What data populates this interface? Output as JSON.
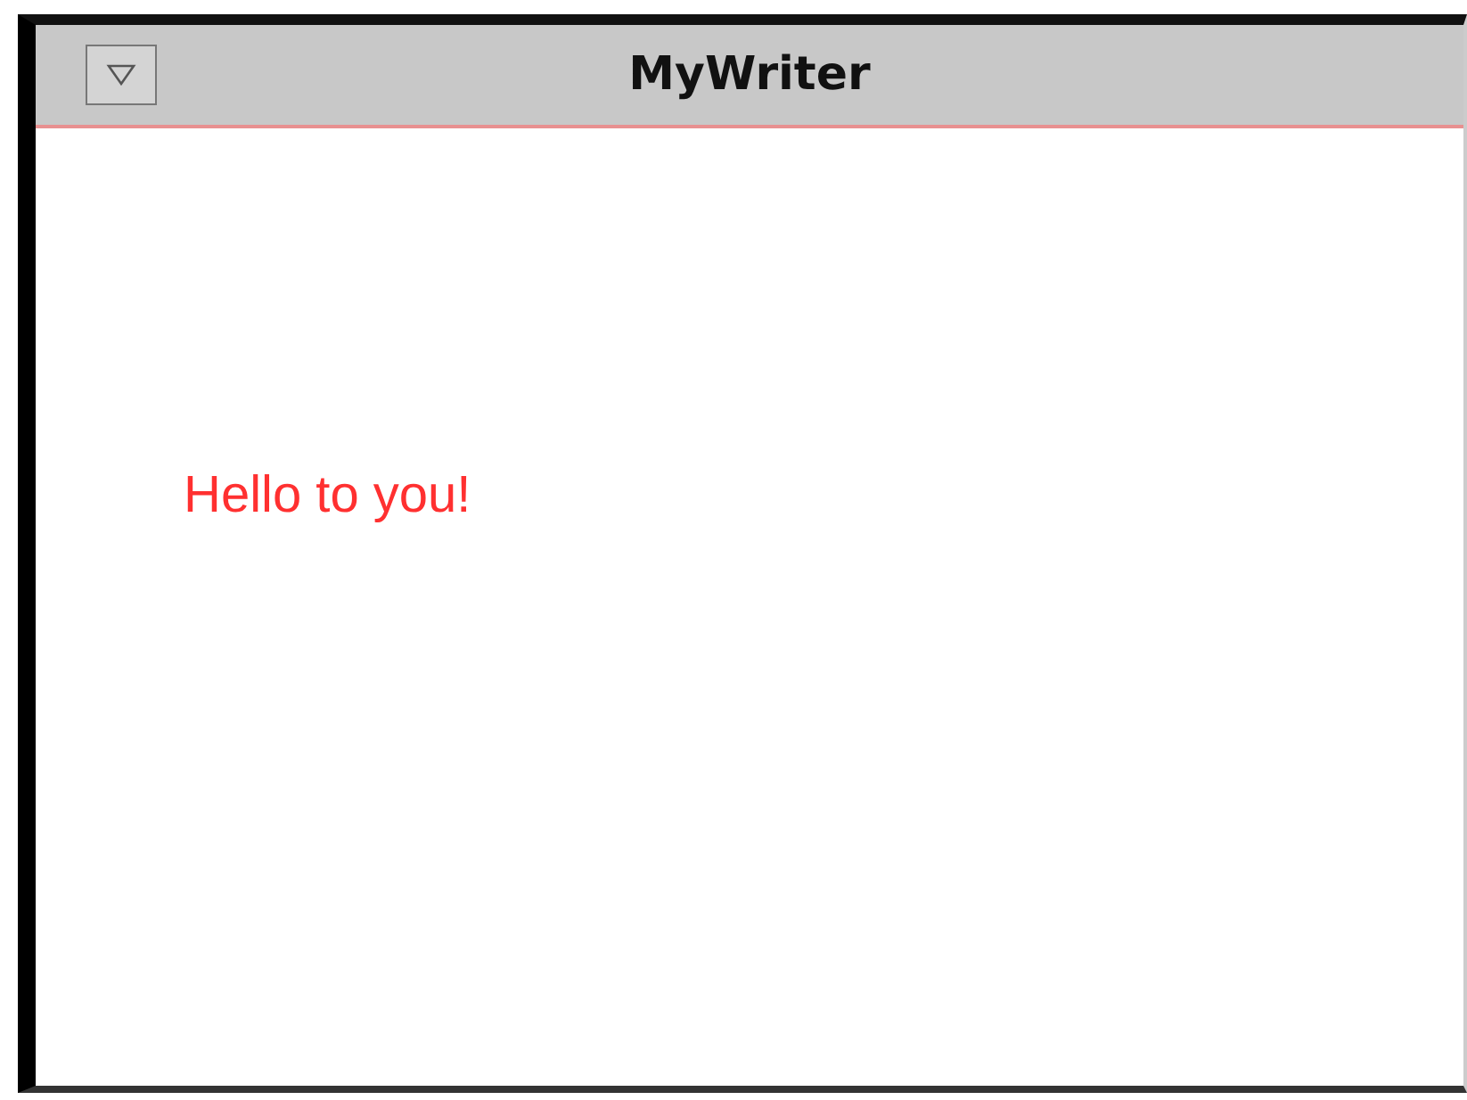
{
  "window": {
    "title": "MyWriter"
  },
  "document": {
    "text": "Hello to you!",
    "color": "#ff3030"
  }
}
